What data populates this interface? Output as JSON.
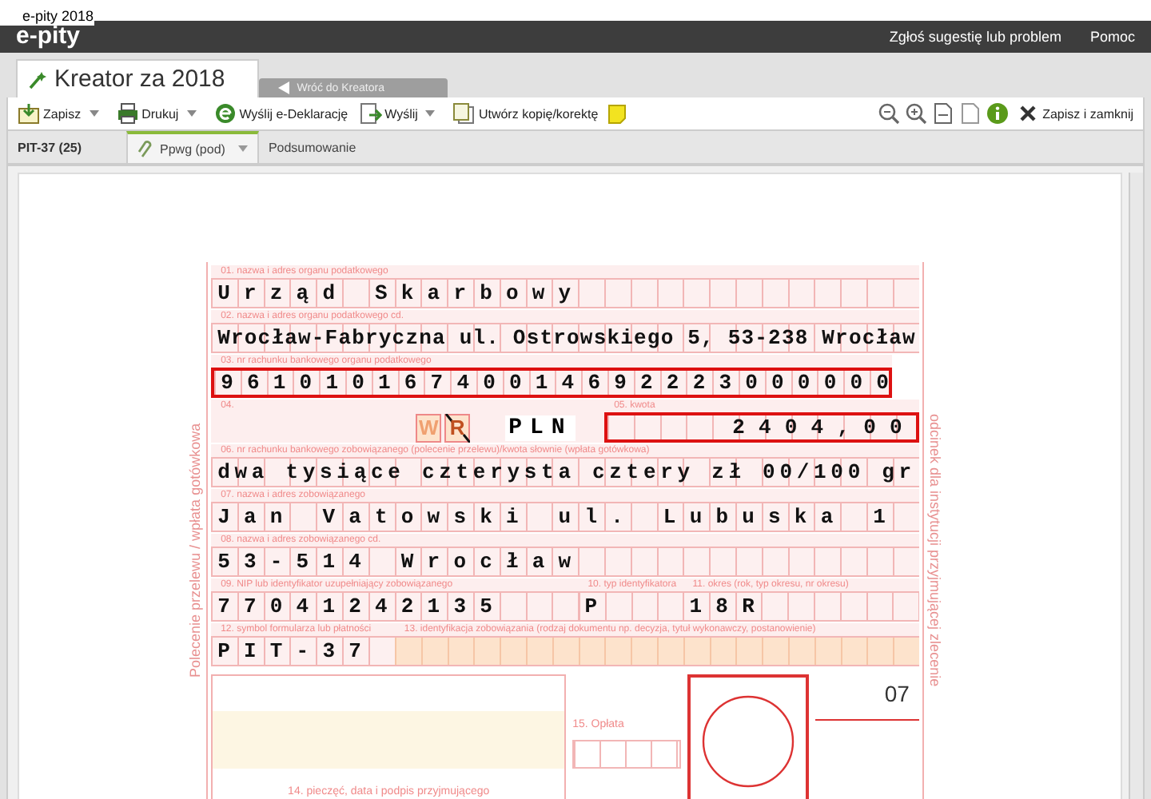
{
  "window": {
    "title": "e-pity 2018"
  },
  "header": {
    "logo": "e-pity",
    "links": [
      "Zgłoś sugestię lub problem",
      "Pomoc"
    ]
  },
  "tabs": [
    {
      "label": "Kreator za 2018",
      "selected": true
    },
    {
      "label": "Wróć do Kreatora",
      "selected": false
    }
  ],
  "toolbar": {
    "left": [
      {
        "label": "Zapisz",
        "dropdown": true
      },
      {
        "label": "Drukuj",
        "dropdown": true
      },
      {
        "label": "Wyślij e-Deklarację",
        "dropdown": false
      },
      {
        "label": "Wyślij",
        "dropdown": true
      },
      {
        "label": "Utwórz kopię/korektę",
        "dropdown": false
      }
    ],
    "close_label": "Zapisz i zamknij"
  },
  "subtabs": [
    {
      "label": "PIT-37 (25)",
      "kind": "title"
    },
    {
      "label": "Ppwg (pod)",
      "kind": "tab",
      "selected": true
    },
    {
      "label": "Podsumowanie",
      "kind": "tab",
      "selected": false
    }
  ],
  "form": {
    "side_left": "Polecenie przelewu / wpłata gotówkowa",
    "side_right": "odcinek dla instytucji przyjmującej zlecenie",
    "rows": [
      [
        {
          "kind": "cells",
          "label": "01. nazwa i adres organu podatkowego",
          "value": "Urząd Skarbowy"
        }
      ],
      [
        {
          "kind": "cells",
          "label": "02. nazwa i adres organu podatkowego cd.",
          "value": "Wrocław-Fabryczna ul. Ostrowskiego 5, 53-238 Wrocław"
        }
      ],
      [
        {
          "kind": "cells",
          "label": "03. nr rachunku bankowego organu podatkowego",
          "value": "96101016740014692223000000",
          "framed": true
        }
      ],
      [
        {
          "kind": "choice",
          "label": "04.",
          "options": [
            {
              "label": "W",
              "selected": true
            },
            {
              "label": "R",
              "selected": false
            }
          ],
          "currency": "PLN"
        },
        {
          "kind": "amount",
          "label": "05. kwota",
          "value": "2404,00",
          "framed": true
        }
      ],
      [
        {
          "kind": "cells",
          "label": "06. nr rachunku bankowego zobowiązanego (polecenie przelewu)/kwota słownie (wpłata gotówkowa)",
          "value": "dwa tysiące czterysta cztery zł 00/100 gr"
        }
      ],
      [
        {
          "kind": "cells",
          "label": "07. nazwa i adres zobowiązanego",
          "value": "Jan Vatowski ul. Lubuska 1"
        }
      ],
      [
        {
          "kind": "cells",
          "label": "08. nazwa i adres zobowiązanego cd.",
          "value": "53-514 Wrocław"
        }
      ],
      [
        {
          "kind": "cells",
          "label": "09. NIP lub identyfikator uzupełniający zobowiązanego",
          "value": "77041242135"
        },
        {
          "kind": "cells",
          "label": "10. typ identyfikatora",
          "value": "P"
        },
        {
          "kind": "cells",
          "label": "11. okres (rok, typ okresu, nr okresu)",
          "value": "18R"
        }
      ],
      [
        {
          "kind": "cells",
          "label": "12. symbol formularza lub płatności",
          "value": "PIT-37"
        },
        {
          "kind": "blank",
          "label": "13. identyfikacja zobowiązania (rodzaj dokumentu np. decyzja, tytuł wykonawczy, postanowienie)"
        }
      ]
    ],
    "number": "07",
    "fee_label": "15. Opłata",
    "stamp_label": "14. pieczęć, data i podpis przyjmującego"
  }
}
